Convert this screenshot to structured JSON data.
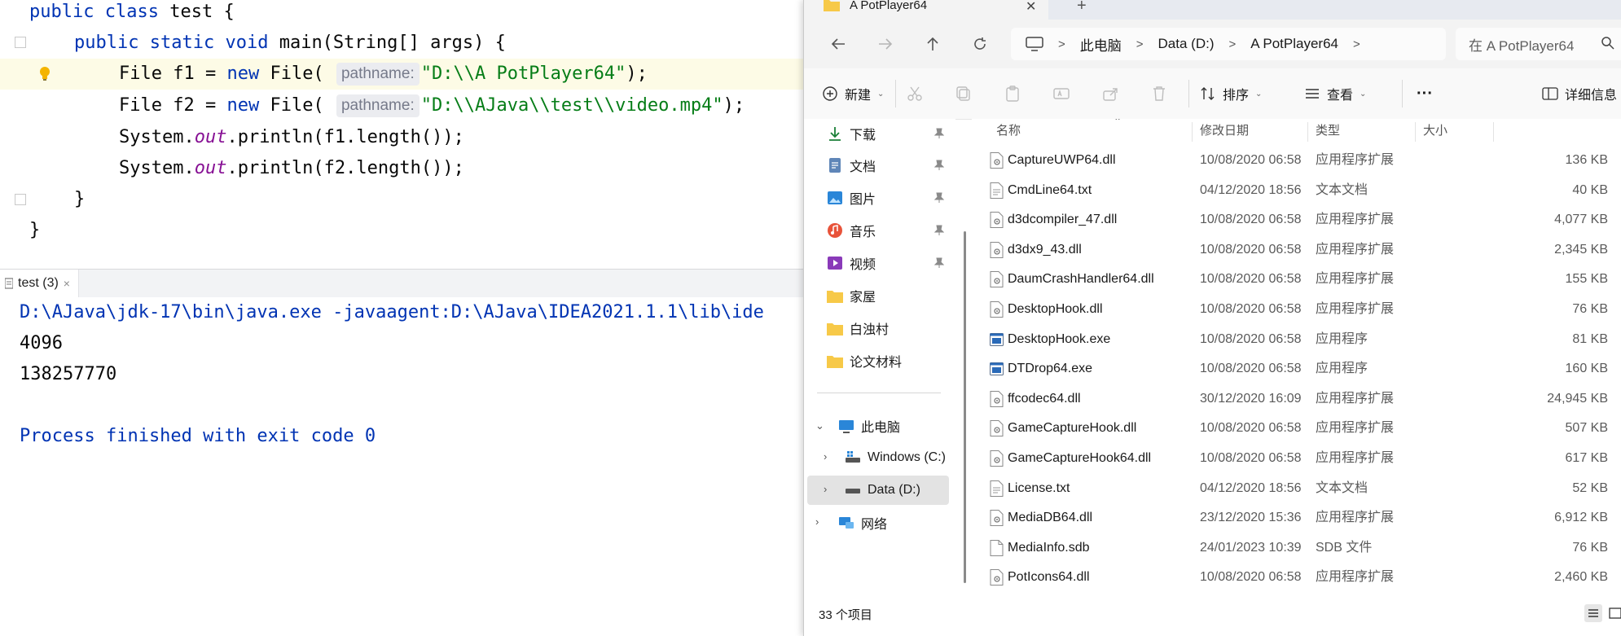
{
  "editor": {
    "lines": {
      "l1": {
        "kw1": "public",
        "kw2": "class",
        "rest": "test {"
      },
      "l2": {
        "kw1": "public",
        "kw2": "static",
        "kw3": "void",
        "rest": "main(String[] args) {"
      },
      "l3": {
        "pre": "File f1 = ",
        "kw": "new",
        "call": "File(",
        "hint": "pathname:",
        "str": "\"D:\\\\A PotPlayer64\"",
        "end": ");"
      },
      "l4": {
        "pre": "File f2 = ",
        "kw": "new",
        "call": "File(",
        "hint": "pathname:",
        "str": "\"D:\\\\AJava\\\\test\\\\video.mp4\"",
        "end": ");"
      },
      "l5": {
        "pre": "System.",
        "field": "out",
        "post": ".println(f1.length());"
      },
      "l6": {
        "pre": "System.",
        "field": "out",
        "post": ".println(f2.length());"
      },
      "l7": "}",
      "l8": "}"
    }
  },
  "console": {
    "tab_label": "test (3)",
    "tab_close": "×",
    "command": "D:\\AJava\\jdk-17\\bin\\java.exe -javaagent:D:\\AJava\\IDEA2021.1.1\\lib\\ide",
    "output": [
      "4096",
      "138257770"
    ],
    "exit": "Process finished with exit code 0"
  },
  "explorer": {
    "tab_title": "A PotPlayer64",
    "tab_close": "✕",
    "new_tab": "+",
    "breadcrumb": [
      "此电脑",
      "Data (D:)",
      "A PotPlayer64"
    ],
    "search_placeholder": "在 A PotPlayer64",
    "commands": {
      "new": "新建",
      "sort": "排序",
      "view": "查看",
      "more": "···",
      "details": "详细信息"
    },
    "sidebar": {
      "quick": [
        {
          "label": "下载",
          "icon": "download-icon"
        },
        {
          "label": "文档",
          "icon": "document-icon"
        },
        {
          "label": "图片",
          "icon": "pictures-icon"
        },
        {
          "label": "音乐",
          "icon": "music-icon"
        },
        {
          "label": "视频",
          "icon": "video-icon"
        },
        {
          "label": "家屋",
          "icon": "folder-icon"
        },
        {
          "label": "白浊村",
          "icon": "folder-icon"
        },
        {
          "label": "论文材料",
          "icon": "folder-icon"
        }
      ],
      "this_pc": "此电脑",
      "drives": [
        "Windows (C:)",
        "Data (D:)"
      ],
      "network": "网络"
    },
    "columns": {
      "name": "名称",
      "date": "修改日期",
      "type": "类型",
      "size": "大小"
    },
    "files": [
      {
        "name": "CaptureUWP64.dll",
        "date": "10/08/2020 06:58",
        "type": "应用程序扩展",
        "size": "136 KB",
        "kind": "dll"
      },
      {
        "name": "CmdLine64.txt",
        "date": "04/12/2020 18:56",
        "type": "文本文档",
        "size": "40 KB",
        "kind": "txt"
      },
      {
        "name": "d3dcompiler_47.dll",
        "date": "10/08/2020 06:58",
        "type": "应用程序扩展",
        "size": "4,077 KB",
        "kind": "dll"
      },
      {
        "name": "d3dx9_43.dll",
        "date": "10/08/2020 06:58",
        "type": "应用程序扩展",
        "size": "2,345 KB",
        "kind": "dll"
      },
      {
        "name": "DaumCrashHandler64.dll",
        "date": "10/08/2020 06:58",
        "type": "应用程序扩展",
        "size": "155 KB",
        "kind": "dll"
      },
      {
        "name": "DesktopHook.dll",
        "date": "10/08/2020 06:58",
        "type": "应用程序扩展",
        "size": "76 KB",
        "kind": "dll"
      },
      {
        "name": "DesktopHook.exe",
        "date": "10/08/2020 06:58",
        "type": "应用程序",
        "size": "81 KB",
        "kind": "exe"
      },
      {
        "name": "DTDrop64.exe",
        "date": "10/08/2020 06:58",
        "type": "应用程序",
        "size": "160 KB",
        "kind": "exe"
      },
      {
        "name": "ffcodec64.dll",
        "date": "30/12/2020 16:09",
        "type": "应用程序扩展",
        "size": "24,945 KB",
        "kind": "dll"
      },
      {
        "name": "GameCaptureHook.dll",
        "date": "10/08/2020 06:58",
        "type": "应用程序扩展",
        "size": "507 KB",
        "kind": "dll"
      },
      {
        "name": "GameCaptureHook64.dll",
        "date": "10/08/2020 06:58",
        "type": "应用程序扩展",
        "size": "617 KB",
        "kind": "dll"
      },
      {
        "name": "License.txt",
        "date": "04/12/2020 18:56",
        "type": "文本文档",
        "size": "52 KB",
        "kind": "txt"
      },
      {
        "name": "MediaDB64.dll",
        "date": "23/12/2020 15:36",
        "type": "应用程序扩展",
        "size": "6,912 KB",
        "kind": "dll"
      },
      {
        "name": "MediaInfo.sdb",
        "date": "24/01/2023 10:39",
        "type": "SDB 文件",
        "size": "76 KB",
        "kind": "file"
      },
      {
        "name": "PotIcons64.dll",
        "date": "10/08/2020 06:58",
        "type": "应用程序扩展",
        "size": "2,460 KB",
        "kind": "dll"
      }
    ],
    "status": "33 个项目"
  }
}
